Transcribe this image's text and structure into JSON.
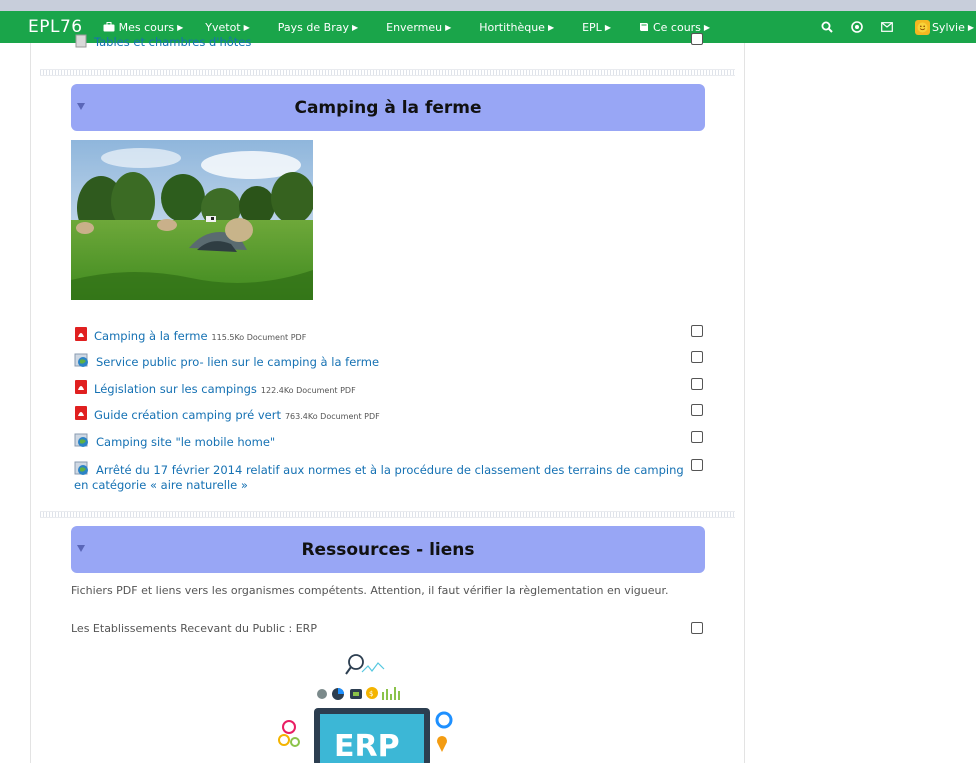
{
  "navbar": {
    "brand": "EPL76",
    "items": [
      {
        "label": "Mes cours",
        "icon": "briefcase-icon"
      },
      {
        "label": "Yvetot"
      },
      {
        "label": "Pays de Bray"
      },
      {
        "label": "Envermeu"
      },
      {
        "label": "Hortithèque"
      },
      {
        "label": "EPL"
      },
      {
        "label": "Ce cours",
        "icon": "book-icon"
      }
    ],
    "right_icons": [
      "search-icon",
      "target-icon",
      "mail-icon"
    ],
    "user": {
      "name": "Sylvie",
      "avatar": "smiley-avatar"
    },
    "color": "#1aa54a"
  },
  "previous_item": {
    "label": "Tables et chambres d'hôtes"
  },
  "sections": [
    {
      "title": "Camping à la ferme",
      "header_color": "#98a6f5",
      "image": "campsite-photo",
      "activities": [
        {
          "label": "Camping à la ferme",
          "meta": "115.5Ko Document PDF",
          "icon": "pdf-icon"
        },
        {
          "label": "Service public pro- lien sur le camping à la ferme",
          "meta": "",
          "icon": "url-icon"
        },
        {
          "label": "Législation sur les campings",
          "meta": "122.4Ko Document PDF",
          "icon": "pdf-icon"
        },
        {
          "label": "Guide création camping pré vert",
          "meta": "763.4Ko Document PDF",
          "icon": "pdf-icon"
        },
        {
          "label": "Camping site \"le mobile home\"",
          "meta": "",
          "icon": "url-icon"
        },
        {
          "label_line1": "Arrêté du 17 février 2014 relatif aux normes et à la procédure de classement des terrains de camping",
          "label_line2": "en catégorie « aire naturelle »",
          "icon": "url-icon"
        }
      ]
    },
    {
      "title": "Ressources - liens",
      "header_color": "#98a6f5",
      "summary": "Fichiers PDF et liens vers les organismes compétents. Attention, il faut vérifier la règlementation en vigueur.",
      "label_item": "Les Etablissements Recevant du Public : ERP",
      "erp_text": "ERP"
    }
  ]
}
